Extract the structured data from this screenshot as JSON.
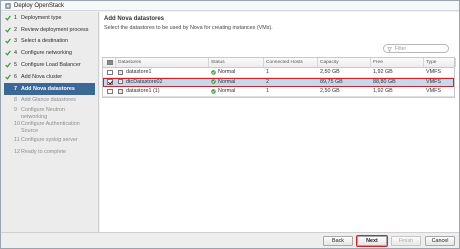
{
  "window": {
    "title": "Deploy OpenStack"
  },
  "sidebar": {
    "steps": [
      {
        "num": "1",
        "label": "Deployment type",
        "state": "done"
      },
      {
        "num": "2",
        "label": "Review deployment process",
        "state": "done"
      },
      {
        "num": "3",
        "label": "Select a destination",
        "state": "done"
      },
      {
        "num": "4",
        "label": "Configure networking",
        "state": "done"
      },
      {
        "num": "5",
        "label": "Configure Load Balancer",
        "state": "done"
      },
      {
        "num": "6",
        "label": "Add Nova cluster",
        "state": "done"
      },
      {
        "num": "7",
        "label": "Add Nova datastores",
        "state": "active"
      },
      {
        "num": "8",
        "label": "Add Glance datastores",
        "state": "pending"
      },
      {
        "num": "9",
        "label": "Configure Neutron networking",
        "state": "pending"
      },
      {
        "num": "10",
        "label": "Configure Authentication Source",
        "state": "pending"
      },
      {
        "num": "11",
        "label": "Configure syslog server",
        "state": "pending"
      },
      {
        "num": "12",
        "label": "Ready to complete",
        "state": "pending"
      }
    ]
  },
  "main": {
    "title": "Add Nova datastores",
    "description": "Select the datastores to be used by Nova for creating instances (VMs).",
    "filter_placeholder": "Filter",
    "columns": [
      "Datastores",
      "Status",
      "Connected Hosts",
      "Capacity",
      "Free",
      "Type"
    ],
    "rows": [
      {
        "checked": false,
        "selected": false,
        "name": "datastore1",
        "status": "Normal",
        "hosts": "1",
        "capacity": "2,50 GB",
        "free": "1,92 GB",
        "type": "VMFS"
      },
      {
        "checked": true,
        "selected": true,
        "name": "dtcDatastore02",
        "status": "Normal",
        "hosts": "2",
        "capacity": "89,75 GB",
        "free": "88,80 GB",
        "type": "VMFS"
      },
      {
        "checked": false,
        "selected": false,
        "name": "datastore1 (1)",
        "status": "Normal",
        "hosts": "1",
        "capacity": "2,50 GB",
        "free": "1,92 GB",
        "type": "VMFS"
      }
    ]
  },
  "footer": {
    "back": "Back",
    "next": "Next",
    "finish": "Finish",
    "cancel": "Cancel"
  },
  "colors": {
    "active_step": "#3c6898",
    "done_check": "#3a9a3a",
    "status_ok": "#3a9a3a",
    "selected_row": "#c3d9ee",
    "highlight": "#d2232a"
  },
  "icons": {
    "title": "vsphere-app-icon",
    "done_step": "check-icon",
    "filter": "filter-icon",
    "datastore": "datastore-icon",
    "status": "ok-status-icon"
  }
}
